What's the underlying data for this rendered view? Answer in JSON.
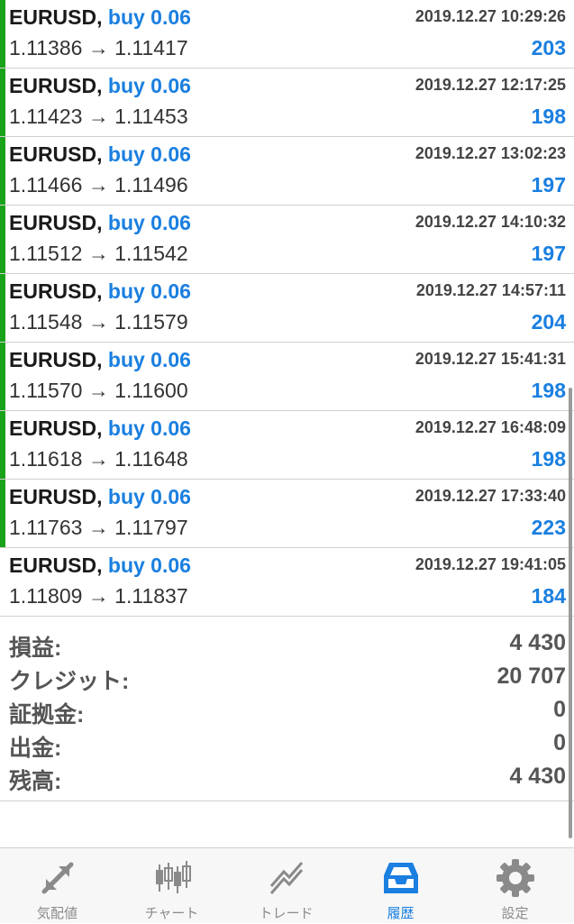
{
  "trades": [
    {
      "symbol": "EURUSD,",
      "action": "buy 0.06",
      "time": "2019.12.27 10:29:26",
      "prices": "1.11386 → 1.11417",
      "profit": "203"
    },
    {
      "symbol": "EURUSD,",
      "action": "buy 0.06",
      "time": "2019.12.27 12:17:25",
      "prices": "1.11423 → 1.11453",
      "profit": "198"
    },
    {
      "symbol": "EURUSD,",
      "action": "buy 0.06",
      "time": "2019.12.27 13:02:23",
      "prices": "1.11466 → 1.11496",
      "profit": "197"
    },
    {
      "symbol": "EURUSD,",
      "action": "buy 0.06",
      "time": "2019.12.27 14:10:32",
      "prices": "1.11512 → 1.11542",
      "profit": "197"
    },
    {
      "symbol": "EURUSD,",
      "action": "buy 0.06",
      "time": "2019.12.27 14:57:11",
      "prices": "1.11548 → 1.11579",
      "profit": "204"
    },
    {
      "symbol": "EURUSD,",
      "action": "buy 0.06",
      "time": "2019.12.27 15:41:31",
      "prices": "1.11570 → 1.11600",
      "profit": "198"
    },
    {
      "symbol": "EURUSD,",
      "action": "buy 0.06",
      "time": "2019.12.27 16:48:09",
      "prices": "1.11618 → 1.11648",
      "profit": "198"
    },
    {
      "symbol": "EURUSD,",
      "action": "buy 0.06",
      "time": "2019.12.27 17:33:40",
      "prices": "1.11763 → 1.11797",
      "profit": "223"
    },
    {
      "symbol": "EURUSD,",
      "action": "buy 0.06",
      "time": "2019.12.27 19:41:05",
      "prices": "1.11809 → 1.11837",
      "profit": "184"
    }
  ],
  "summary": [
    {
      "label": "損益:",
      "value": "4 430"
    },
    {
      "label": "クレジット:",
      "value": "20 707"
    },
    {
      "label": "証拠金:",
      "value": "0"
    },
    {
      "label": "出金:",
      "value": "0"
    },
    {
      "label": "残高:",
      "value": "4 430"
    }
  ],
  "nav": [
    {
      "label": "気配値",
      "icon": "quotes-icon",
      "active": false
    },
    {
      "label": "チャート",
      "icon": "chart-icon",
      "active": false
    },
    {
      "label": "トレード",
      "icon": "trade-icon",
      "active": false
    },
    {
      "label": "履歴",
      "icon": "history-icon",
      "active": true
    },
    {
      "label": "設定",
      "icon": "settings-icon",
      "active": false
    }
  ],
  "colors": {
    "accent": "#1a7fe0",
    "buy_bar": "#1aa31a"
  }
}
